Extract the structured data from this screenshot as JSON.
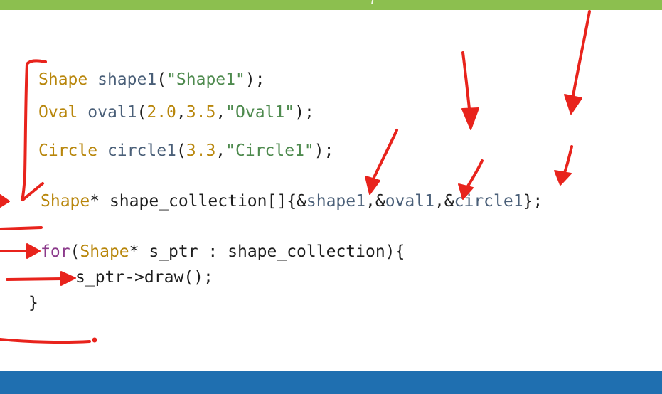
{
  "colors": {
    "top_bar": "#8cbf4f",
    "bottom_bar": "#1f6fb0",
    "annotation": "#e8231c",
    "type": "#b8860b",
    "identifier": "#4a5f78",
    "string": "#4e8a4e",
    "keyword": "#8b3a8b"
  },
  "code": {
    "line1": {
      "type": "Shape",
      "name": "shape1",
      "open": "(",
      "arg": "\"Shape1\"",
      "close": ");"
    },
    "line2": {
      "type": "Oval",
      "name": "oval1",
      "open": "(",
      "n1": "2.0",
      "c1": ",",
      "n2": "3.5",
      "c2": ",",
      "arg": "\"Oval1\"",
      "close": ");"
    },
    "line3": {
      "type": "Circle",
      "name": "circle1",
      "open": "(",
      "n1": "3.3",
      "c1": ",",
      "arg": "\"Circle1\"",
      "close": ");"
    },
    "line4": {
      "type": "Shape",
      "rest": "* shape_collection[]{&",
      "a1": "shape1",
      "s1": ",&",
      "a2": "oval1",
      "s2": ",&",
      "a3": "circle1",
      "close": "};"
    },
    "line5": {
      "keyword": "for",
      "open": "(",
      "type": "Shape",
      "rest": "* s_ptr : shape_collection){"
    },
    "line6": "s_ptr->draw();",
    "line7": "}"
  },
  "annotations": [
    "bracket-left",
    "arrow-to-shape1",
    "arrow-to-oval1",
    "arrow-to-circle1",
    "arrow-down-mid",
    "arrow-down-right",
    "arrow-to-for",
    "arrow-to-draw",
    "underline-bottom"
  ]
}
